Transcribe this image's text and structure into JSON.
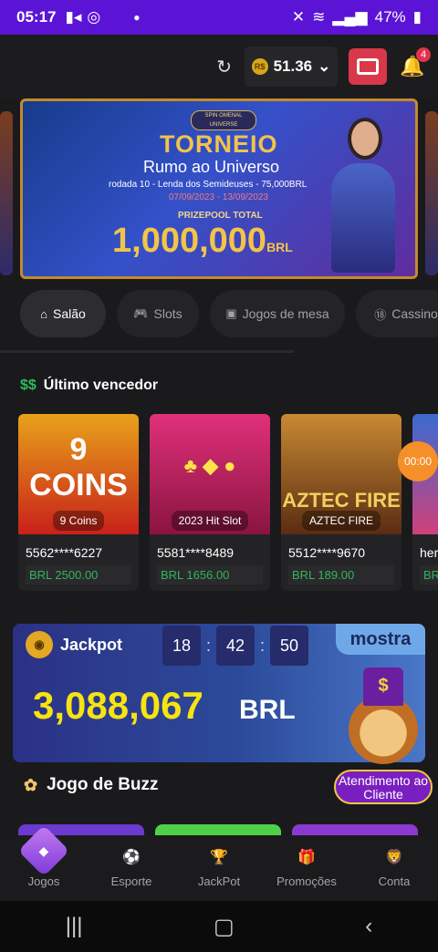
{
  "status_bar": {
    "time": "05:17",
    "battery": "47%"
  },
  "header": {
    "balance": "51.36",
    "notification_count": "4",
    "coin_label": "R$"
  },
  "banner": {
    "logo": "SPIN OMENAL UNIVERSE",
    "title": "TORNEIO",
    "subtitle": "Rumo ao Universo",
    "rodada": "rodada 10 - Lenda dos Semideuses - 75,000BRL",
    "dates": "07/09/2023 - 13/09/2023",
    "prizepool_label": "PRIZEPOOL TOTAL",
    "amount": "1,000,000",
    "currency": "BRL"
  },
  "tabs": [
    {
      "label": "Salão",
      "icon": "home-icon"
    },
    {
      "label": "Slots",
      "icon": "gamepad-icon"
    },
    {
      "label": "Jogos de mesa",
      "icon": "cards-icon"
    },
    {
      "label": "Cassino",
      "icon": "18-icon"
    }
  ],
  "last_winner": {
    "title": "Último vencedor",
    "cards": [
      {
        "game": "9 Coins",
        "image_text": "9 COINS",
        "id": "5562****6227",
        "amount": "BRL 2500.00",
        "color": "#d8241a"
      },
      {
        "game": "2023 Hit Slot",
        "image_text": "2023 Hit Slot",
        "id": "5581****8489",
        "amount": "BRL 1656.00",
        "color": "#c21d5a"
      },
      {
        "game": "AZTEC FIRE",
        "image_text": "AZTEC FIRE",
        "id": "5512****9670",
        "amount": "BRL 189.00",
        "color": "#a66a1b"
      },
      {
        "game": "",
        "image_text": "",
        "id": "her",
        "amount": "BRL",
        "color": "#3a6bd0"
      }
    ],
    "timer": "00:00"
  },
  "jackpot": {
    "title": "Jackpot",
    "clock": {
      "h": "18",
      "m": "42",
      "s": "50"
    },
    "amount": "3,088,067",
    "currency": "BRL",
    "tag": "mostra"
  },
  "buzz": {
    "title": "Jogo de Buzz"
  },
  "support": {
    "label": "Atendimento ao Cliente"
  },
  "bottom_nav": [
    {
      "label": "Jogos",
      "icon": "diamond-icon"
    },
    {
      "label": "Esporte",
      "icon": "soccer-ball-icon"
    },
    {
      "label": "JackPot",
      "icon": "trophy-icon"
    },
    {
      "label": "Promoções",
      "icon": "gift-icon"
    },
    {
      "label": "Conta",
      "icon": "lion-avatar-icon"
    }
  ]
}
